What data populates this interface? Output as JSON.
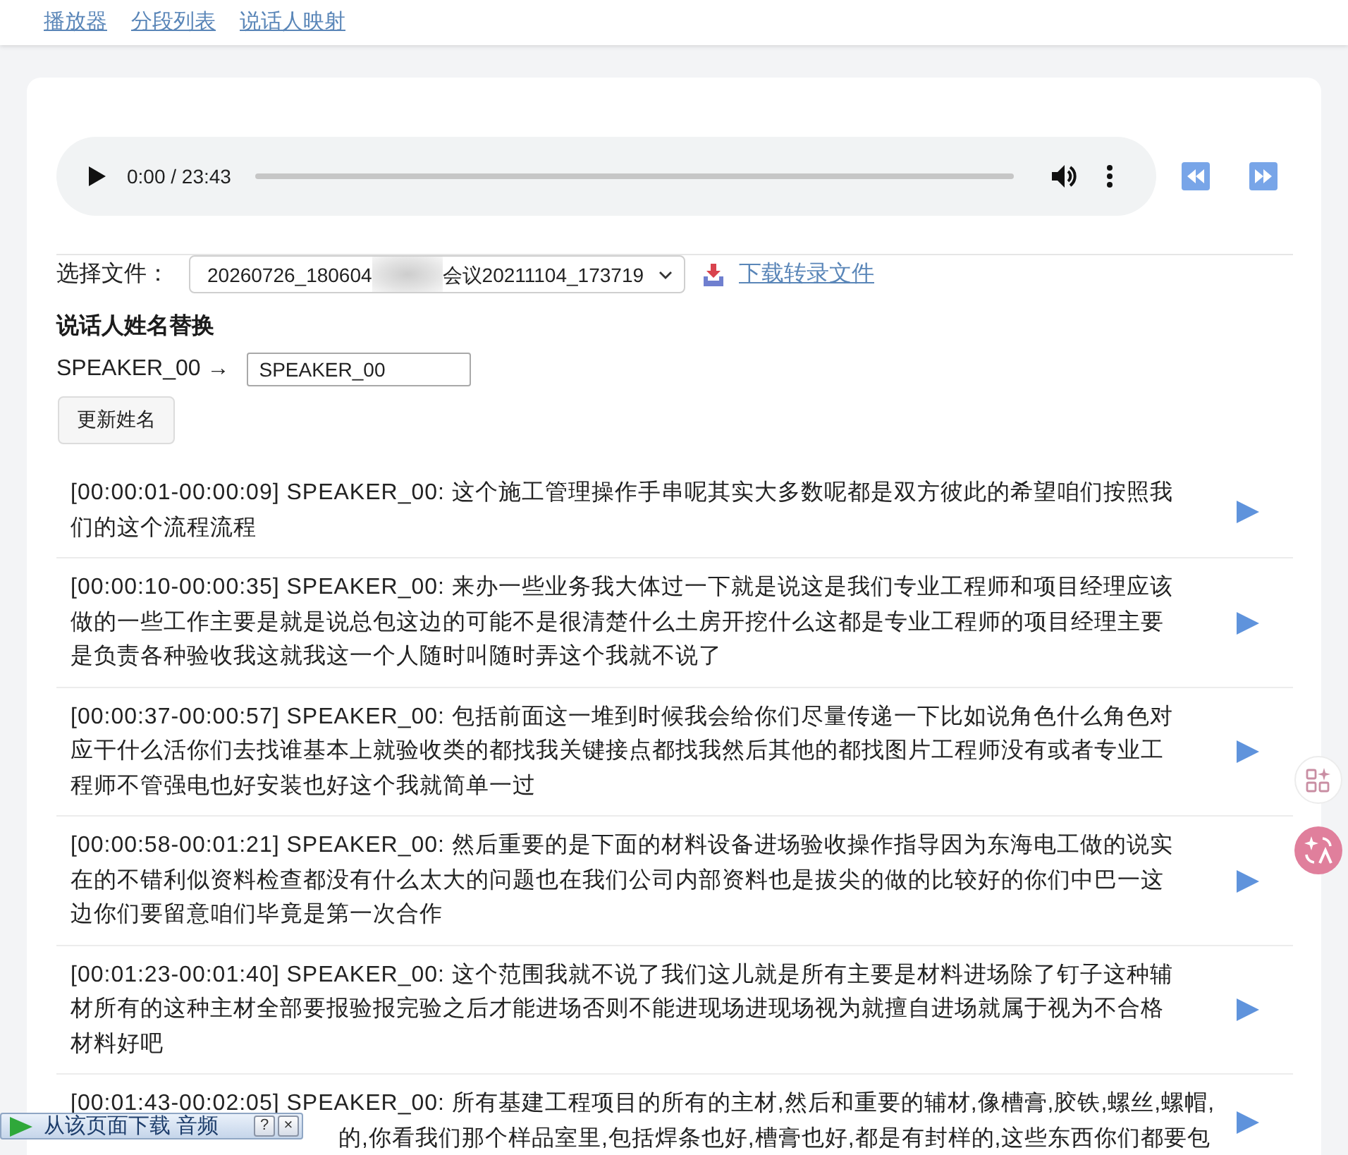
{
  "nav": {
    "links": [
      "播放器",
      "分段列表",
      "说话人映射"
    ]
  },
  "player": {
    "time": "0:00 / 23:43"
  },
  "file_select": {
    "label": "选择文件：",
    "value_start": "20260726_180604",
    "value_end": "会议20211104_173719"
  },
  "download_link": {
    "label": "下载转录文件"
  },
  "speaker_rename": {
    "heading": "说话人姓名替换",
    "mappings": [
      {
        "speaker": "SPEAKER_00 →",
        "value": "SPEAKER_00"
      }
    ],
    "button": "更新姓名"
  },
  "segments": [
    {
      "text": "[00:00:01-00:00:09] SPEAKER_00: 这个施工管理操作手串呢其实大多数呢都是双方彼此的希望咱们按照我们的这个流程流程"
    },
    {
      "text": "[00:00:10-00:00:35] SPEAKER_00: 来办一些业务我大体过一下就是说这是我们专业工程师和项目经理应该做的一些工作主要是就是说总包这边的可能不是很清楚什么土房开挖什么这都是专业工程师的项目经理主要是负责各种验收我这就我这一个人随时叫随时弄这个我就不说了"
    },
    {
      "text": "[00:00:37-00:00:57] SPEAKER_00: 包括前面这一堆到时候我会给你们尽量传递一下比如说角色什么角色对应干什么活你们去找谁基本上就验收类的都找我关键接点都找我然后其他的都找图片工程师没有或者专业工程师不管强电也好安装也好这个我就简单一过"
    },
    {
      "text": "[00:00:58-00:01:21] SPEAKER_00: 然后重要的是下面的材料设备进场验收操作指导因为东海电工做的说实在的不错利似资料检查都没有什么太大的问题也在我们公司内部资料也是拔尖的做的比较好的你们中巴一这边你们要留意咱们毕竟是第一次合作"
    },
    {
      "text": "[00:01:23-00:01:40] SPEAKER_00: 这个范围我就不说了我们这儿就是所有主要是材料进场除了钉子这种辅材所有的这种主材全部要报验报完验之后才能进场否则不能进现场进现场视为就擅自进场就属于视为不合格材料好吧"
    },
    {
      "text": "[00:01:43-00:02:05] SPEAKER_00: 所有基建工程项目的所有的主材,然后和重要的辅材,像槽膏,胶铁,螺丝,螺帽,",
      "text_after_overlay": "的,你看我们那个样品室里,包括焊条也好,槽膏也好,都是有封样的,这些东西你们都要包"
    }
  ],
  "download_bar": {
    "label": "从该页面下载 音频",
    "buttons": [
      "?",
      "×"
    ]
  }
}
